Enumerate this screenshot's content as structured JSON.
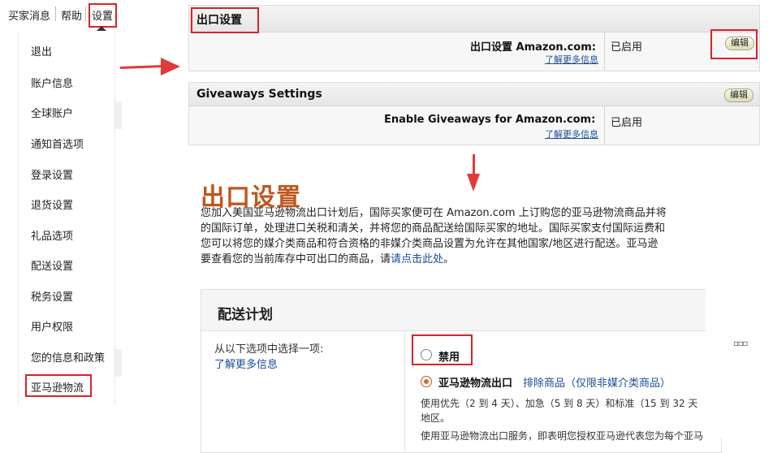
{
  "topnav": {
    "messages": "买家消息",
    "help": "帮助",
    "settings": "设置"
  },
  "menu": {
    "items": [
      {
        "label": "退出"
      },
      {
        "label": "账户信息"
      },
      {
        "label": "全球账户"
      },
      {
        "label": "通知首选项"
      },
      {
        "label": "登录设置"
      },
      {
        "label": "退货设置"
      },
      {
        "label": "礼品选项"
      },
      {
        "label": "配送设置"
      },
      {
        "label": "税务设置"
      },
      {
        "label": "用户权限"
      },
      {
        "label": "您的信息和政策"
      },
      {
        "label": "亚马逊物流"
      }
    ]
  },
  "export_panel": {
    "title": "出口设置",
    "row_label": "出口设置 Amazon.com:",
    "learn_more": "了解更多信息",
    "status": "已启用",
    "edit": "编辑"
  },
  "giveaways_panel": {
    "title": "Giveaways Settings",
    "row_label": "Enable Giveaways for Amazon.com:",
    "learn_more": "了解更多信息",
    "status": "已启用",
    "edit": "编辑"
  },
  "main": {
    "title": "出口设置",
    "para_line1": "您加入美国亚马逊物流出口计划后，国际买家便可在 Amazon.com 上订购您的亚马逊物流商品并将",
    "para_line2": "的国际订单，处理进口关税和清关，并将您的商品配送给国际买家的地址。国际买家支付国际运费和",
    "para_line3": "您可以将您的媒介类商品和符合资格的非媒介类商品设置为允许在其他国家/地区进行配送。亚马逊",
    "para_line4_pre": "要查看您的当前库存中可出口的商品，请",
    "para_line4_link": "请点击此处",
    "para_line4_post": "。"
  },
  "delivery": {
    "title": "配送计划",
    "choose_label": "从以下选项中选择一项:",
    "learn_more": "了解更多信息",
    "option_disable": "禁用",
    "option_fba_export": "亚马逊物流出口",
    "exclude_link": "排除商品（仅限非媒介类商品）",
    "desc_line1": "使用优先（2 到 4 天）、加急（5 到 8 天）和标准（15 到 32 天",
    "desc_line2": "地区。",
    "desc_line3": "使用亚马逊物流出口服务，即表明您授权亚马逊代表您为每个亚马",
    "selected": "亚马逊物流出口"
  },
  "colors": {
    "accent_title": "#c0561f",
    "annotation_red": "#d9222a",
    "link": "#1a4d99"
  }
}
